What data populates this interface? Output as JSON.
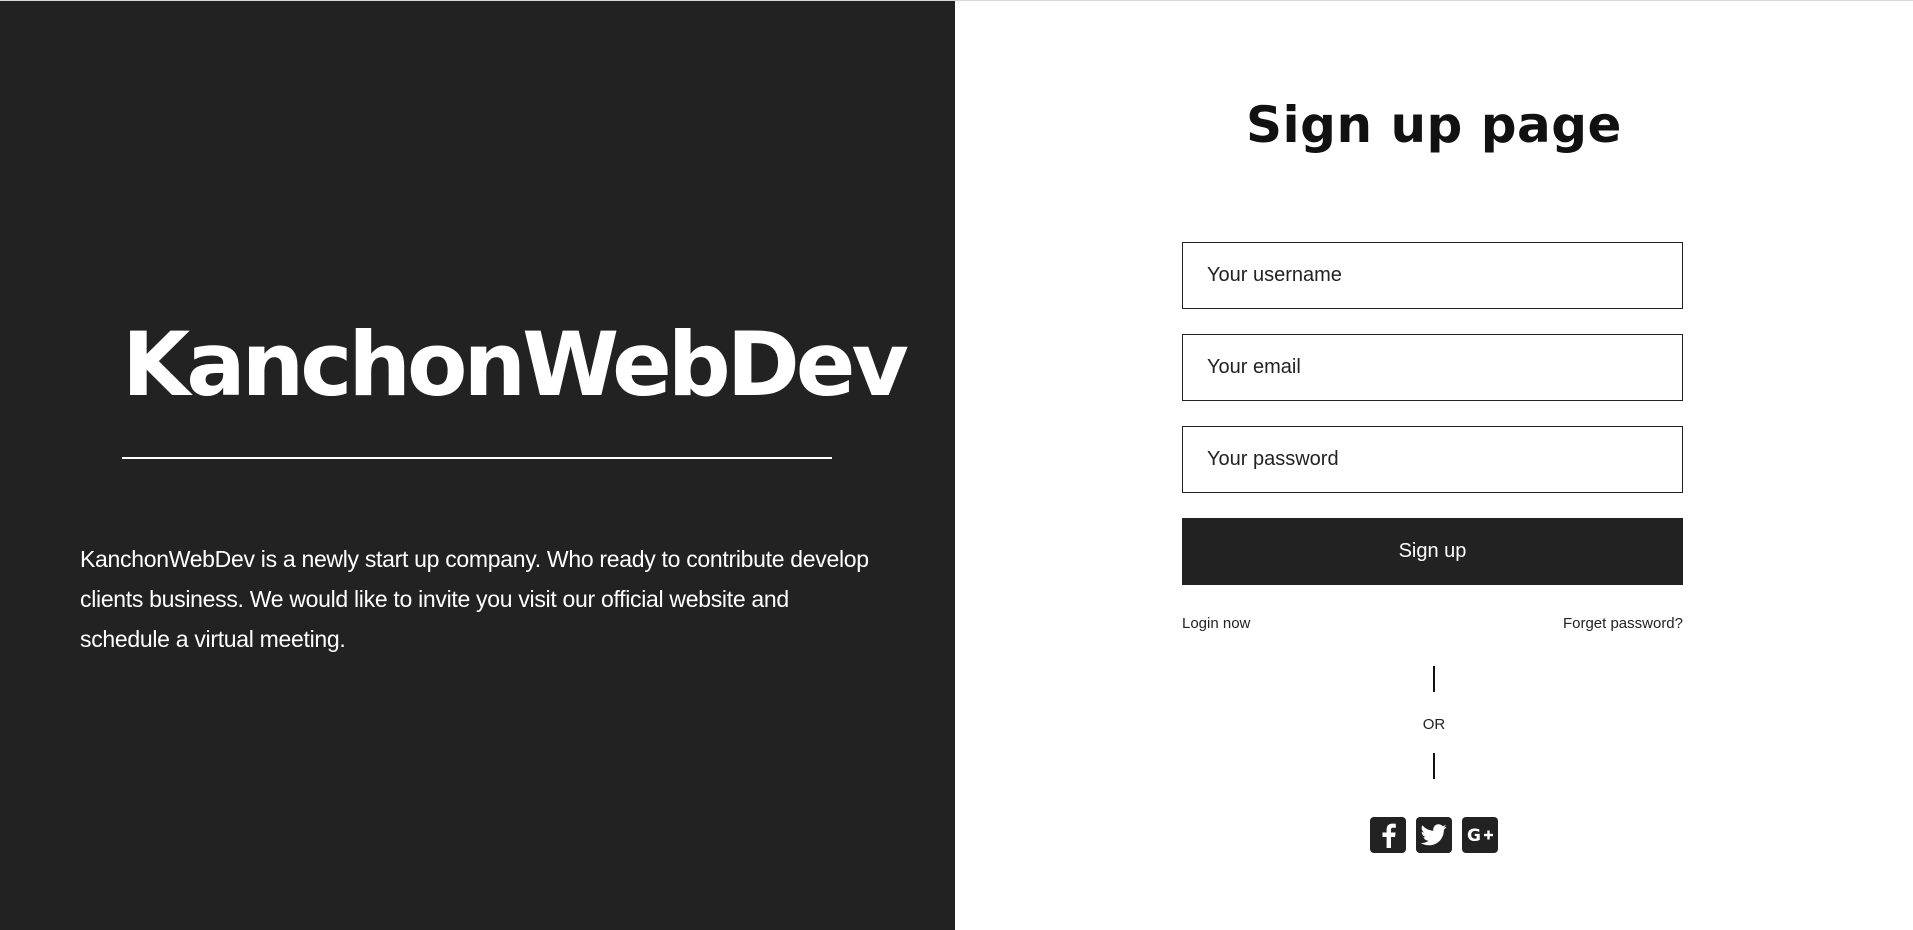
{
  "left": {
    "brand": "KanchonWebDev",
    "description": "KanchonWebDev is a newly start up company. Who ready to contribute develop clients business. We would like to invite you visit our official website and schedule a virtual meeting."
  },
  "right": {
    "title": "Sign up page",
    "fields": {
      "username_placeholder": "Your username",
      "email_placeholder": "Your email",
      "password_placeholder": "Your password"
    },
    "signup_label": "Sign up",
    "login_link": "Login now",
    "forgot_link": "Forget password?",
    "or_text": "OR",
    "socials": [
      {
        "icon": "facebook-icon"
      },
      {
        "icon": "twitter-icon"
      },
      {
        "icon": "google-plus-icon"
      }
    ]
  },
  "colors": {
    "dark": "#222222",
    "light": "#ffffff"
  }
}
